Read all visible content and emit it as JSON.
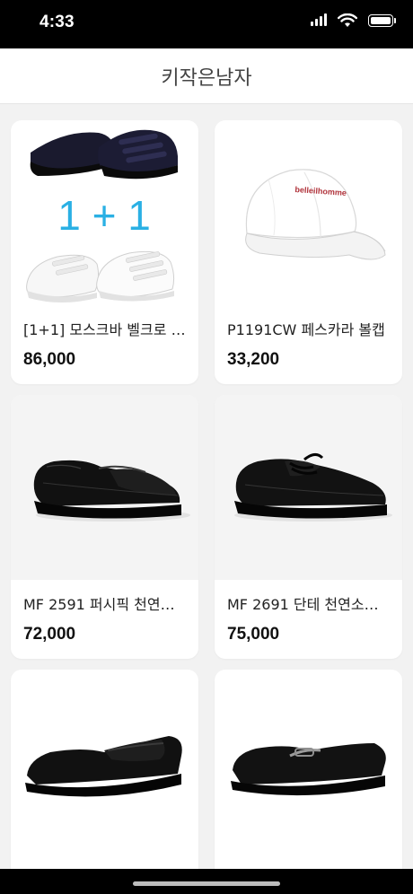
{
  "status": {
    "time": "4:33"
  },
  "nav": {
    "title": "키작은남자"
  },
  "promo": {
    "badge": "1 + 1",
    "cap_logo": "belleilhomme"
  },
  "products": [
    {
      "name": "[1+1] 모스크바 벨크로 스니커즈",
      "price": "86,000"
    },
    {
      "name": "P1191CW 페스카라 볼캡",
      "price": "33,200"
    },
    {
      "name": "MF 2591 퍼시픽 천연소가죽 로퍼",
      "price": "72,000"
    },
    {
      "name": "MF 2691 단테 천연소가죽 더비",
      "price": "75,000"
    },
    {
      "name": "",
      "price": ""
    },
    {
      "name": "",
      "price": ""
    }
  ]
}
